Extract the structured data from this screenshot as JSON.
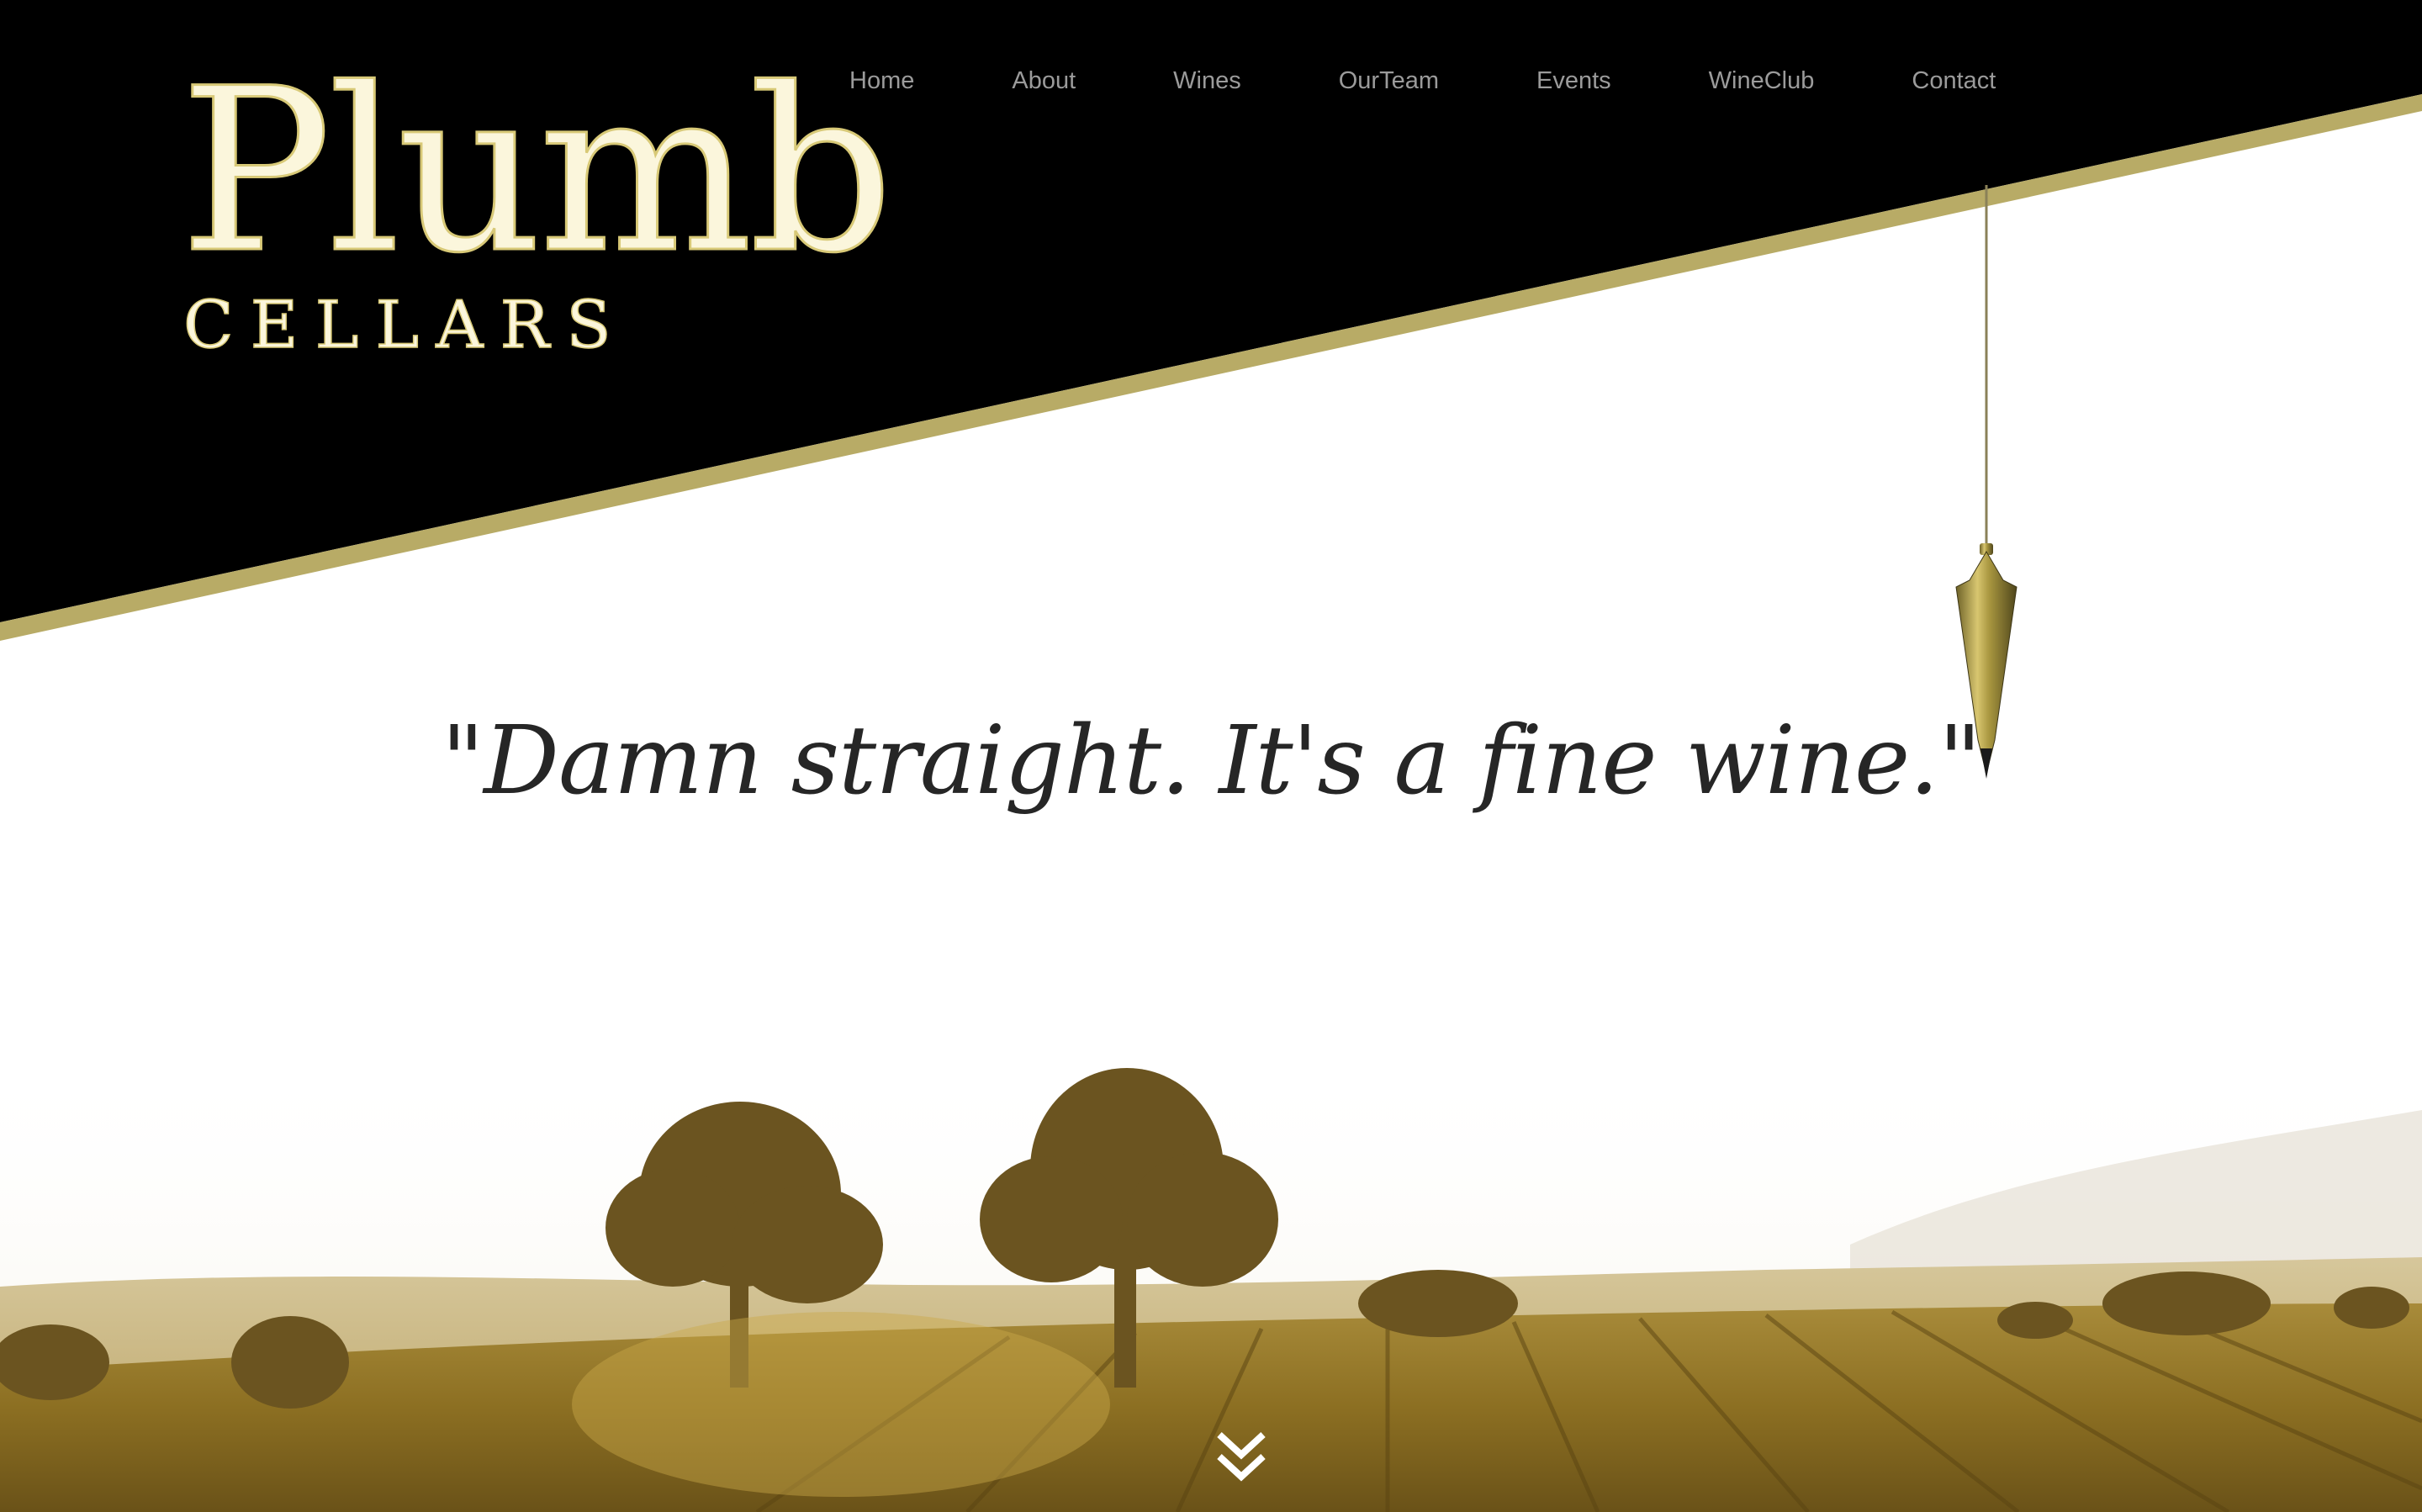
{
  "brand": {
    "name": "Plumb",
    "subtitle": "CELLARS"
  },
  "nav": {
    "items": [
      {
        "label": "Home"
      },
      {
        "label": "About"
      },
      {
        "label": "Wines"
      },
      {
        "label": "OurTeam"
      },
      {
        "label": "Events"
      },
      {
        "label": "WineClub"
      },
      {
        "label": "Contact"
      }
    ]
  },
  "hero": {
    "tagline": "\"Damn straight. It's a fine wine.\""
  },
  "icons": {
    "plumb_bob": "plumb-bob-icon",
    "scroll": "chevron-double-down-icon"
  },
  "colors": {
    "header_bg": "#000000",
    "accent_gold": "#b8ab66",
    "logo_cream": "#fbf6dc",
    "nav_text": "#9b9b9b",
    "tagline_text": "#262626"
  }
}
